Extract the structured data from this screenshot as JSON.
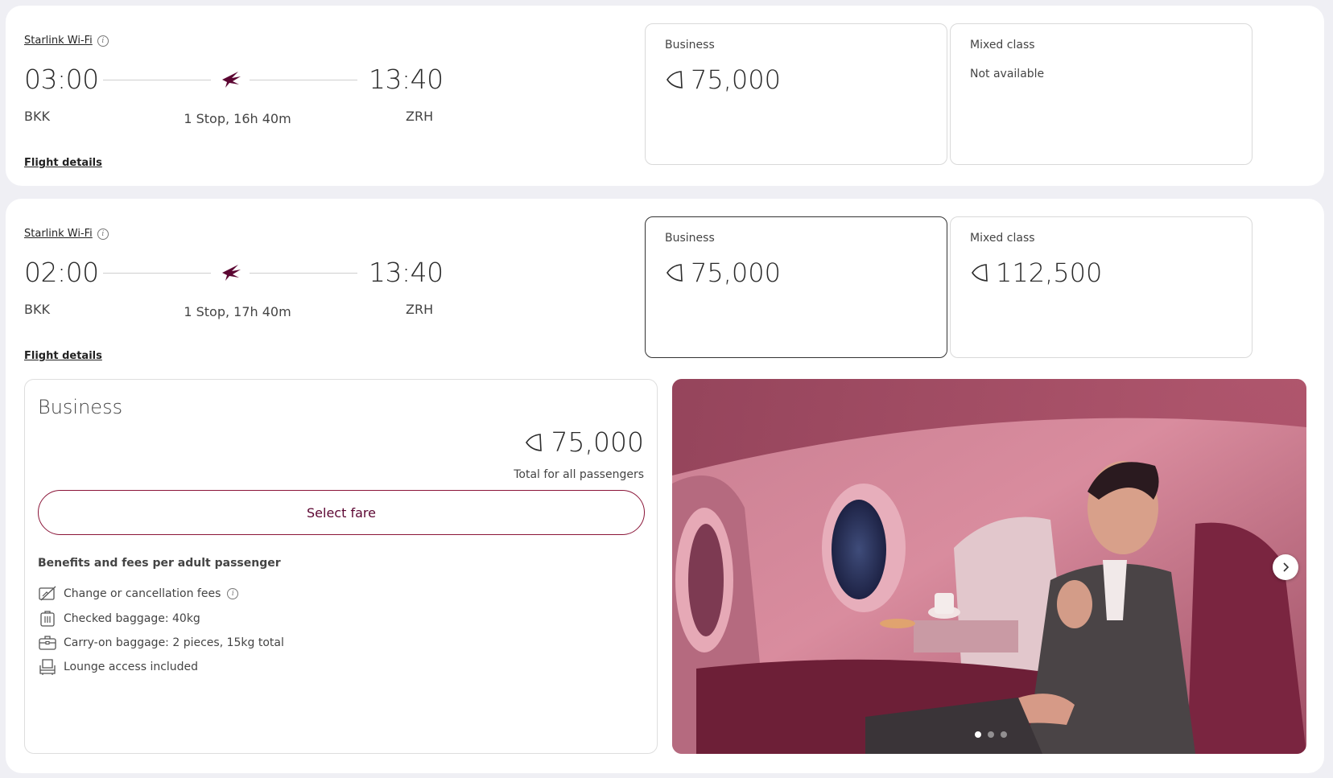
{
  "colors": {
    "brand": "#5c0632",
    "brand_border": "#8a1538",
    "page_background": "#efeff4"
  },
  "flights": [
    {
      "wifi_label": "Starlink Wi-Fi",
      "departure_time": "03:00",
      "arrival_time": "13:40",
      "origin": "BKK",
      "destination": "ZRH",
      "stops_duration": "1 Stop, 16h 40m",
      "details_link": "Flight details",
      "fares": [
        {
          "label": "Business",
          "value": "75,000",
          "available": true,
          "selected": false
        },
        {
          "label": "Mixed class",
          "value": "Not available",
          "available": false,
          "selected": false
        }
      ]
    },
    {
      "wifi_label": "Starlink Wi-Fi",
      "departure_time": "02:00",
      "arrival_time": "13:40",
      "origin": "BKK",
      "destination": "ZRH",
      "stops_duration": "1 Stop, 17h 40m",
      "details_link": "Flight details",
      "fares": [
        {
          "label": "Business",
          "value": "75,000",
          "available": true,
          "selected": true
        },
        {
          "label": "Mixed class",
          "value": "112,500",
          "available": true,
          "selected": false
        }
      ]
    }
  ],
  "fare_detail": {
    "title": "Business",
    "price": "75,000",
    "price_note": "Total for all passengers",
    "select_button": "Select fare",
    "benefits_title": "Benefits and fees per adult passenger",
    "benefits": [
      {
        "icon": "no-change-fee-icon",
        "text": "Change or cancellation fees"
      },
      {
        "icon": "checked-baggage-icon",
        "text": "Checked baggage: 40kg"
      },
      {
        "icon": "carry-on-baggage-icon",
        "text": "Carry-on baggage: 2 pieces, 15kg total"
      },
      {
        "icon": "lounge-seat-icon",
        "text": "Lounge access included"
      }
    ]
  },
  "carousel": {
    "slide_count": 3,
    "active_slide": 1
  }
}
